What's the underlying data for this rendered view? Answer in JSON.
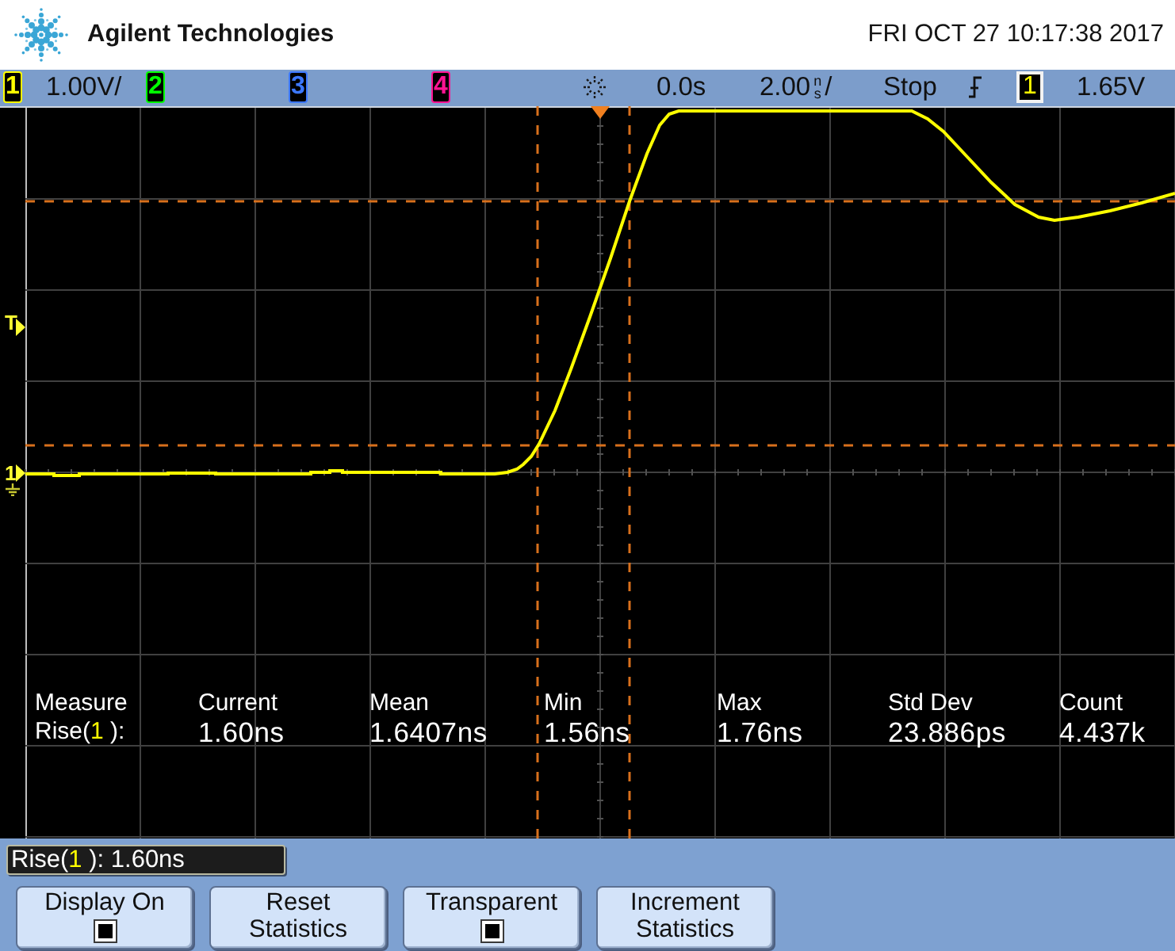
{
  "header": {
    "brand": "Agilent Technologies",
    "datetime": "FRI OCT 27 10:17:38 2017"
  },
  "status_bar": {
    "channels": [
      {
        "number": "1",
        "color": "#ffff00",
        "scale": "1.00V/"
      },
      {
        "number": "2",
        "color": "#00ff00"
      },
      {
        "number": "3",
        "color": "#3c78ff"
      },
      {
        "number": "4",
        "color": "#ff1493"
      }
    ],
    "delay": "0.0s",
    "time_scale": {
      "value": "2.00",
      "unit": "ns",
      "suffix": "/"
    },
    "run_state": "Stop",
    "trigger": {
      "source": "1",
      "level": "1.65V"
    }
  },
  "screen": {
    "markers": {
      "trigger_level": "T",
      "ground": "1"
    },
    "measurements": {
      "header": [
        "Measure",
        "Current",
        "Mean",
        "Min",
        "Max",
        "Std Dev",
        "Count"
      ],
      "label": {
        "prefix": "Rise(",
        "source": "1",
        "suffix": " ):"
      },
      "values": [
        "1.60ns",
        "1.6407ns",
        "1.56ns",
        "1.76ns",
        "23.886ps",
        "4.437k"
      ]
    }
  },
  "readout": {
    "prefix": "Rise(",
    "source": "1",
    "suffix": " ):",
    "value": "1.60ns"
  },
  "softkeys": [
    {
      "label": "Display On",
      "kind": "checkbox",
      "checked": true
    },
    {
      "label": "Reset Statistics",
      "kind": "button"
    },
    {
      "label": "Transparent",
      "kind": "checkbox",
      "checked": true
    },
    {
      "label": "Increment Statistics",
      "kind": "button"
    }
  ]
}
